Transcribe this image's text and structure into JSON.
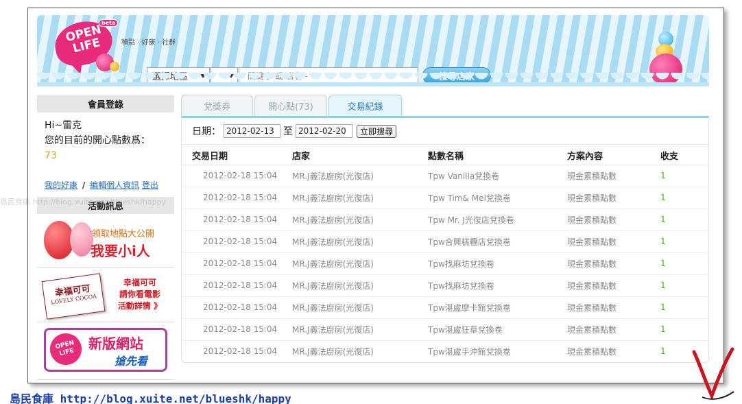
{
  "header": {
    "logo": {
      "line1": "OPEN",
      "line2": "LIFE",
      "beta": "beta"
    },
    "tagline": "積點 · 好康 · 社群",
    "search": {
      "region_select": "選擇地區",
      "sub_select": "",
      "keyword_placeholder": "- 關鍵字 或 店名 -",
      "button": "搜尋店家"
    }
  },
  "sidebar": {
    "login_title": "會員登錄",
    "greeting": "Hi~雷克",
    "points_label": "您的目前的開心點數爲：",
    "points_value": "73",
    "links": {
      "favorites": "我的好康",
      "separator": "/",
      "edit_profile": "編輯個人資訊",
      "logout": "登出"
    },
    "activity_title": "活動訊息",
    "promos": [
      {
        "line1": "領取地點大公開",
        "line2": "我要小i人"
      },
      {
        "brand": "幸福可可",
        "brand_en": "LOVELY COCOA",
        "line1": "幸福可可",
        "line2": "請你看電影",
        "line3": "活動詳情 》"
      },
      {
        "logo1": "OPEN",
        "logo2": "LIFE",
        "line1": "新版網站",
        "line2": "搶先看"
      }
    ]
  },
  "tabs": [
    {
      "label": "兌獎券",
      "active": false
    },
    {
      "label": "開心點(73)",
      "active": false
    },
    {
      "label": "交易紀錄",
      "active": true
    }
  ],
  "filter": {
    "date_label": "日期：",
    "from": "2012-02-13",
    "to_label": "至",
    "to": "2012-02-20",
    "search_button": "立即搜尋"
  },
  "table": {
    "headers": [
      "交易日期",
      "店家",
      "點數名稱",
      "方案內容",
      "收支"
    ],
    "rows": [
      [
        "2012-02-18 15:04",
        "MR.J義法廚房(光復店)",
        "Tpw Vanilla兌換卷",
        "現金累積點數",
        "1"
      ],
      [
        "2012-02-18 15:04",
        "MR.J義法廚房(光復店)",
        "Tpw Tim& Mel兌換卷",
        "現金累積點數",
        "1"
      ],
      [
        "2012-02-18 15:04",
        "MR.J義法廚房(光復店)",
        "Tpw Mr. J光復店兌換卷",
        "現金累積點數",
        "1"
      ],
      [
        "2012-02-18 15:04",
        "MR.J義法廚房(光復店)",
        "Tpw合興糕糰店兌換卷",
        "現金累積點數",
        "1"
      ],
      [
        "2012-02-18 15:04",
        "MR.J義法廚房(光復店)",
        "Tpw找麻坊兌換卷",
        "現金累積點數",
        "1"
      ],
      [
        "2012-02-18 15:04",
        "MR.J義法廚房(光復店)",
        "Tpw找麻坊兌換卷",
        "現金累積點數",
        "1"
      ],
      [
        "2012-02-18 15:04",
        "MR.J義法廚房(光復店)",
        "Tpw湛盧摩卡館兌換卷",
        "現金累積點數",
        "1"
      ],
      [
        "2012-02-18 15:04",
        "MR.J義法廚房(光復店)",
        "Tpw湛盧狂草兌換卷",
        "現金累積點數",
        "1"
      ],
      [
        "2012-02-18 15:04",
        "MR.J義法廚房(光復店)",
        "Tpw湛盧手沖館兌換卷",
        "現金累積點數",
        "1"
      ]
    ]
  },
  "footer": {
    "blog_caption": "島民食庫 http://blog.xuite.net/blueshk/happy",
    "watermark": "島民食庫 http://blog.xuite.net/blueshk/happy"
  },
  "colors": {
    "accent": "#37a4de",
    "brand_pink": "#ea2b7b",
    "income_green": "#4caa2f",
    "points_gold": "#e0a020"
  }
}
